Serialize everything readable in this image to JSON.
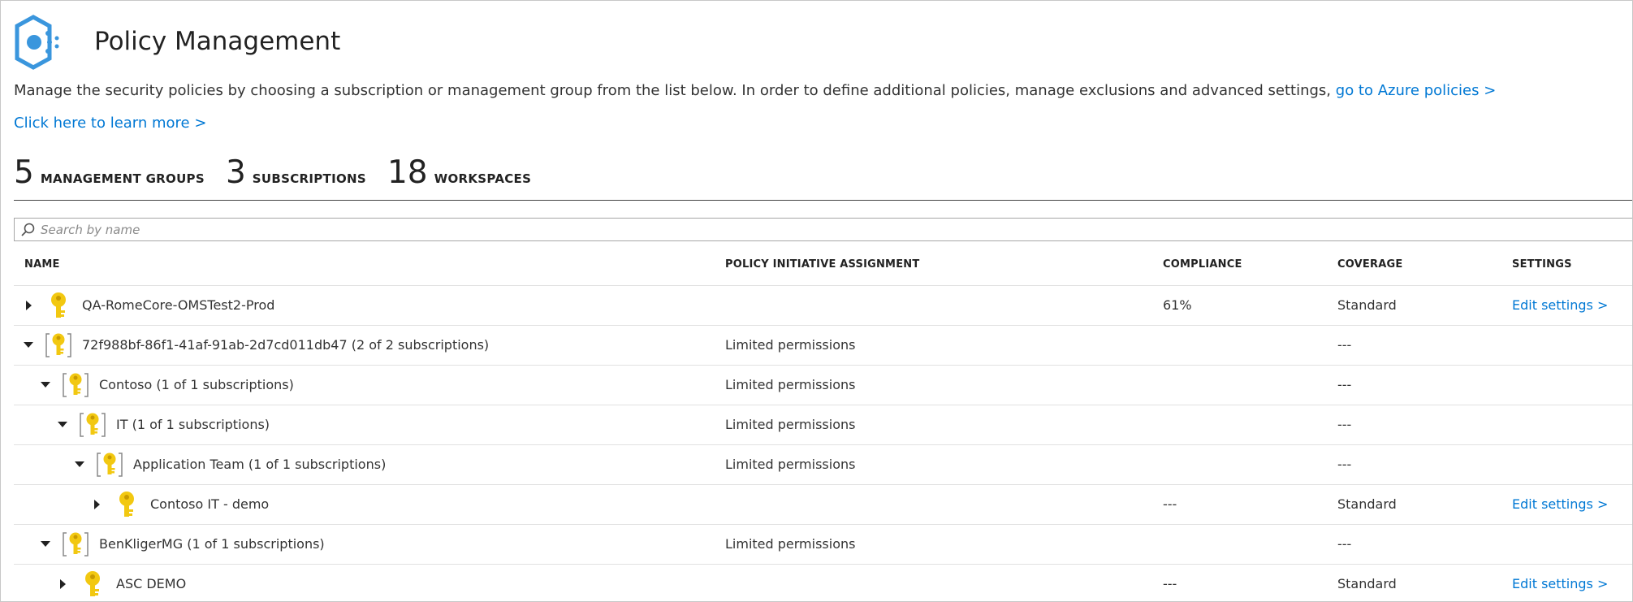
{
  "header": {
    "title": "Policy Management",
    "description": "Manage the security policies by choosing a subscription or management group from the list below. In order to define additional policies, manage exclusions and advanced settings,",
    "azure_link": "go to Azure policies >",
    "learn_more": "Click here to learn more >"
  },
  "stats": [
    {
      "count": "5",
      "label": "MANAGEMENT GROUPS"
    },
    {
      "count": "3",
      "label": "SUBSCRIPTIONS"
    },
    {
      "count": "18",
      "label": "WORKSPACES"
    }
  ],
  "search": {
    "placeholder": "Search by name"
  },
  "columns": {
    "name": "NAME",
    "policy": "POLICY INITIATIVE ASSIGNMENT",
    "compliance": "COMPLIANCE",
    "coverage": "COVERAGE",
    "settings": "SETTINGS"
  },
  "rows": [
    {
      "name": "QA-RomeCore-OMSTest2-Prod",
      "kind": "subscription",
      "expanded": false,
      "policy": "",
      "compliance": "61%",
      "coverage": "Standard",
      "settings": "Edit settings >"
    },
    {
      "name": "72f988bf-86f1-41af-91ab-2d7cd011db47 (2 of 2 subscriptions)",
      "kind": "management-group",
      "expanded": true,
      "policy": "Limited permissions",
      "compliance": "",
      "coverage": "---",
      "settings": ""
    },
    {
      "name": "Contoso (1 of 1 subscriptions)",
      "kind": "management-group",
      "expanded": true,
      "policy": "Limited permissions",
      "compliance": "",
      "coverage": "---",
      "settings": ""
    },
    {
      "name": "IT (1 of 1 subscriptions)",
      "kind": "management-group",
      "expanded": true,
      "policy": "Limited permissions",
      "compliance": "",
      "coverage": "---",
      "settings": ""
    },
    {
      "name": "Application Team (1 of 1 subscriptions)",
      "kind": "management-group",
      "expanded": true,
      "policy": "Limited permissions",
      "compliance": "",
      "coverage": "---",
      "settings": ""
    },
    {
      "name": "Contoso IT - demo",
      "kind": "subscription",
      "expanded": false,
      "policy": "",
      "compliance": "---",
      "coverage": "Standard",
      "settings": "Edit settings >"
    },
    {
      "name": "BenKligerMG (1 of 1 subscriptions)",
      "kind": "management-group",
      "expanded": true,
      "policy": "Limited permissions",
      "compliance": "",
      "coverage": "---",
      "settings": ""
    },
    {
      "name": "ASC DEMO",
      "kind": "subscription",
      "expanded": false,
      "policy": "",
      "compliance": "---",
      "coverage": "Standard",
      "settings": "Edit settings >"
    }
  ],
  "colors": {
    "link": "#0078d4",
    "key": "#f2c811",
    "logo": "#3a96dd"
  }
}
